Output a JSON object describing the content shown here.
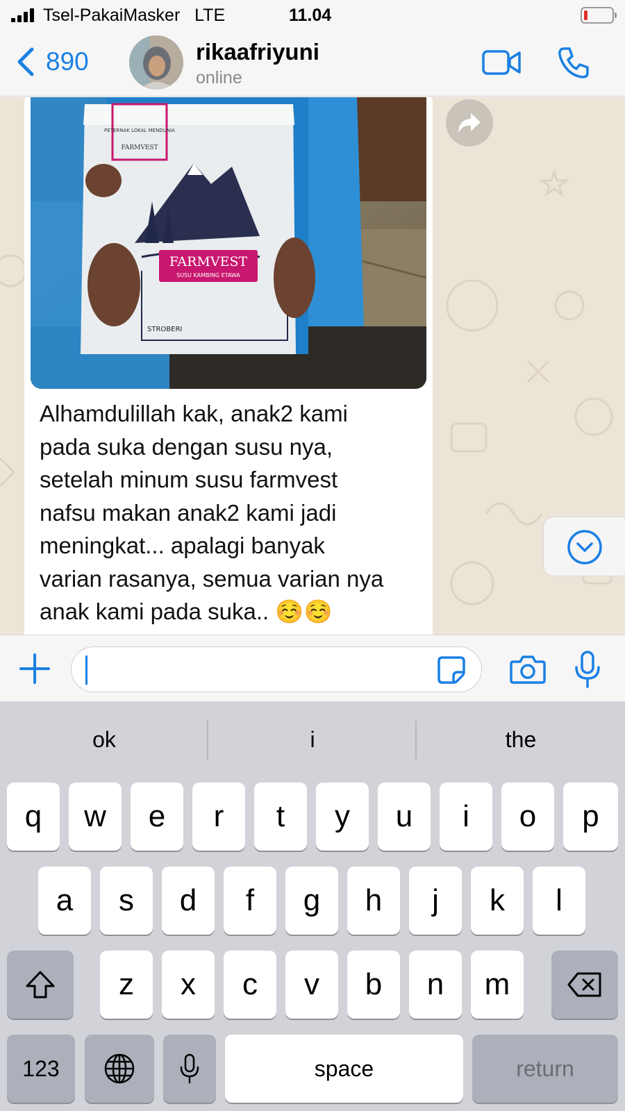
{
  "status_bar": {
    "carrier": "Tsel-PakaiMasker",
    "network": "LTE",
    "time": "11.04"
  },
  "header": {
    "back_count": "890",
    "contact_name": "rikaafriyuni",
    "contact_status": "online",
    "icons": [
      "chevron-left-icon",
      "video-call-icon",
      "phone-icon"
    ]
  },
  "chat": {
    "photo": {
      "brand_top": "PETERNAK LOKAL MENDUNIA",
      "brand_small": "FARMVEST",
      "brand_main": "FARMVEST",
      "product": "SUSU KAMBING ETAWA",
      "flavor": "STROBERI"
    },
    "message_lines": [
      "Alhamdulillah kak, anak2 kami",
      "pada suka dengan susu nya,",
      "setelah minum susu farmvest",
      "nafsu makan anak2 kami jadi",
      "meningkat... apalagi banyak",
      "varian rasanya, semua varian nya",
      "anak kami pada suka.. ☺️☺️"
    ]
  },
  "composer": {
    "value": "",
    "placeholder": ""
  },
  "keyboard": {
    "suggestions": [
      "ok",
      "i",
      "the"
    ],
    "row1": [
      "q",
      "w",
      "e",
      "r",
      "t",
      "y",
      "u",
      "i",
      "o",
      "p"
    ],
    "row2": [
      "a",
      "s",
      "d",
      "f",
      "g",
      "h",
      "j",
      "k",
      "l"
    ],
    "row3": [
      "z",
      "x",
      "c",
      "v",
      "b",
      "n",
      "m"
    ],
    "numbers_label": "123",
    "space_label": "space",
    "return_label": "return"
  },
  "colors": {
    "accent": "#1a80e4",
    "chat_background": "#ede4d8",
    "keyboard_background": "#d1d3d9",
    "brand_pink": "#c8176e"
  }
}
